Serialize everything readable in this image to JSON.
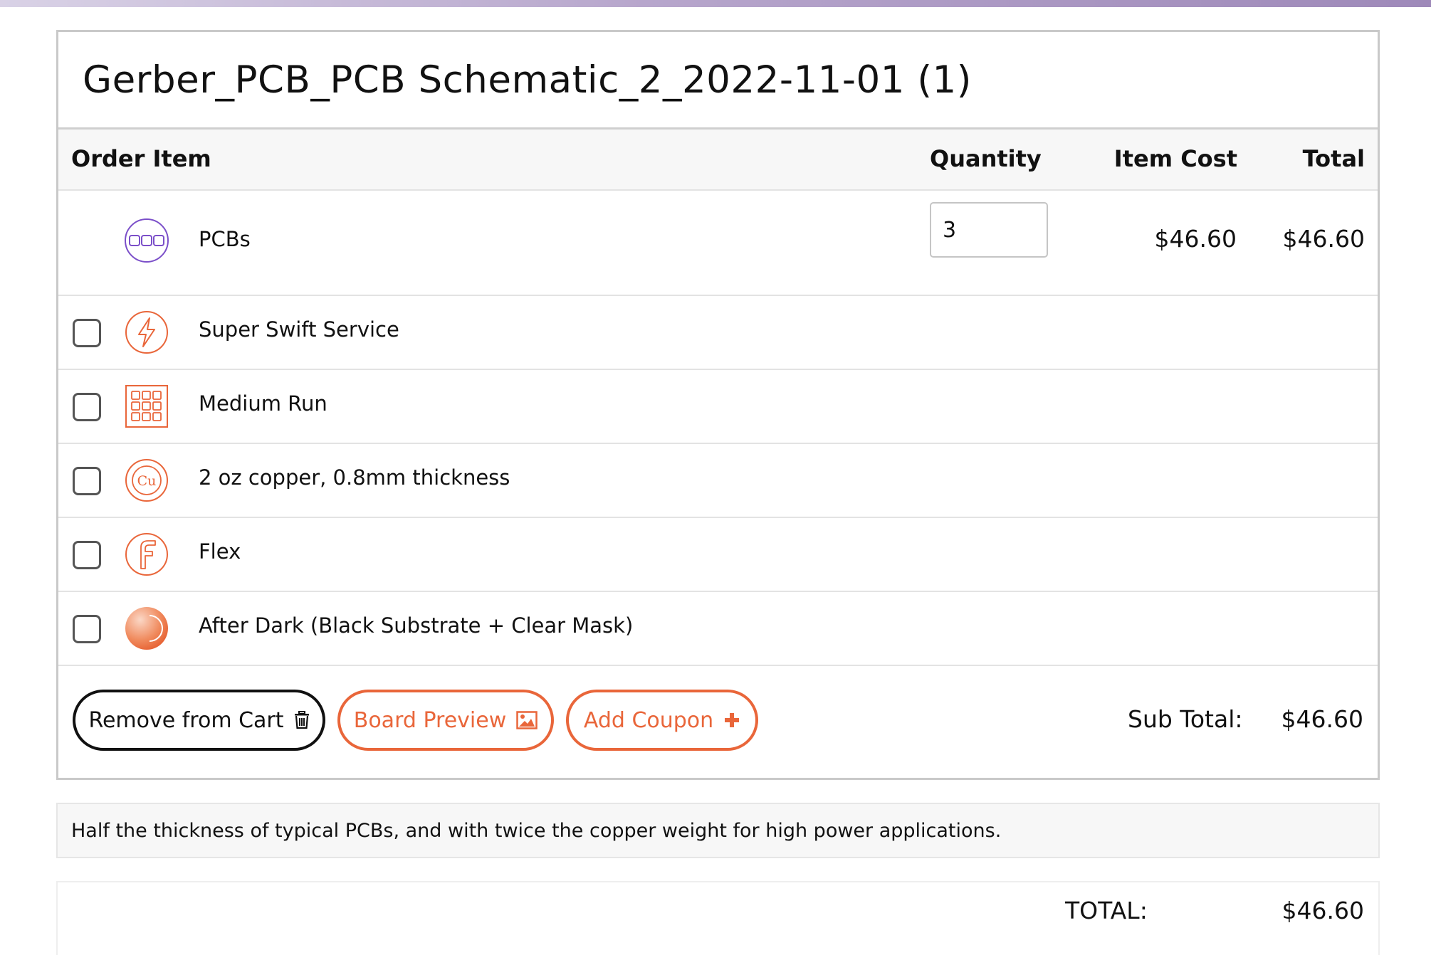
{
  "cart": {
    "title": "Gerber_PCB_PCB Schematic_2_2022-11-01 (1)",
    "headers": {
      "item": "Order Item",
      "quantity": "Quantity",
      "item_cost": "Item Cost",
      "total": "Total"
    },
    "main_item": {
      "icon": "pcb-icon",
      "label": "PCBs",
      "quantity": "3",
      "item_cost": "$46.60",
      "total": "$46.60"
    },
    "options": [
      {
        "icon": "lightning-bolt-icon",
        "label": "Super Swift Service",
        "checked": false
      },
      {
        "icon": "panel-grid-icon",
        "label": "Medium Run",
        "checked": false
      },
      {
        "icon": "copper-cu-icon",
        "label": "2 oz copper, 0.8mm thickness",
        "checked": false
      },
      {
        "icon": "flex-f-icon",
        "label": "Flex",
        "checked": false
      },
      {
        "icon": "moon-icon",
        "label": "After Dark (Black Substrate + Clear Mask)",
        "checked": false
      }
    ],
    "buttons": {
      "remove": "Remove from Cart",
      "preview": "Board Preview",
      "coupon": "Add Coupon"
    },
    "subtotal_label": "Sub Total:",
    "subtotal_value": "$46.60"
  },
  "description": "Half the thickness of typical PCBs, and with twice the copper weight for high power applications.",
  "summary": {
    "total_label": "TOTAL:",
    "total_value": "$46.60"
  },
  "colors": {
    "accent": "#e9663a",
    "pcb_icon": "#7b4fc9",
    "border": "#c9c9c9"
  }
}
